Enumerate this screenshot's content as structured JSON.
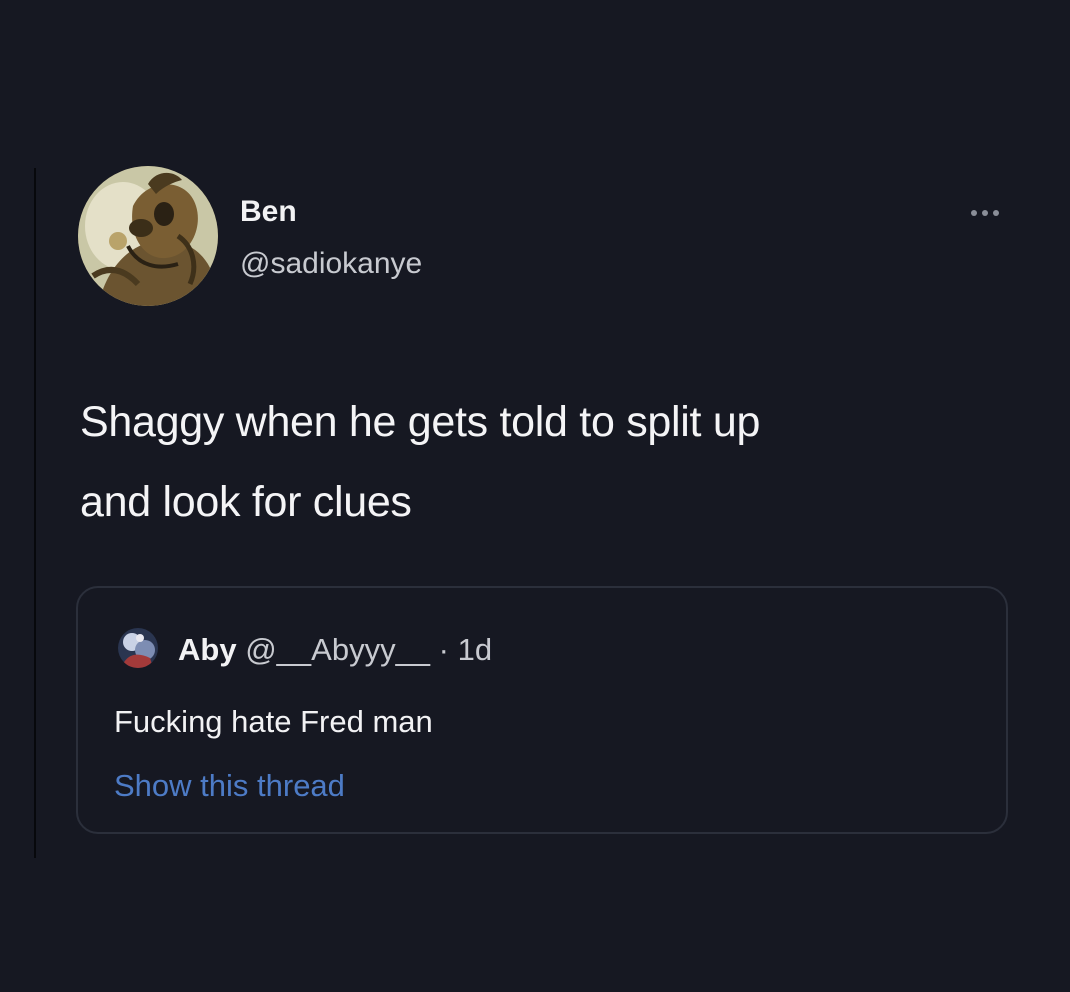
{
  "tweet": {
    "author": {
      "display_name": "Ben",
      "handle": "@sadiokanye",
      "avatar_icon": "cartoon-dog-avatar"
    },
    "more_icon": "more-options-icon",
    "text_lines": [
      "Shaggy when he gets told to split up",
      "and look for clues"
    ],
    "quote": {
      "display_name": "Aby",
      "handle": "@__Abyyy__",
      "separator": "·",
      "time": "1d",
      "text": "Fucking hate Fred man",
      "show_thread_label": "Show this thread",
      "avatar_icon": "quoted-user-avatar"
    }
  },
  "colors": {
    "background": "#161822",
    "text_primary": "#f2f2f4",
    "text_secondary": "#c8cad0",
    "link": "#4d7bc6",
    "card_border": "#2b2f3b"
  }
}
